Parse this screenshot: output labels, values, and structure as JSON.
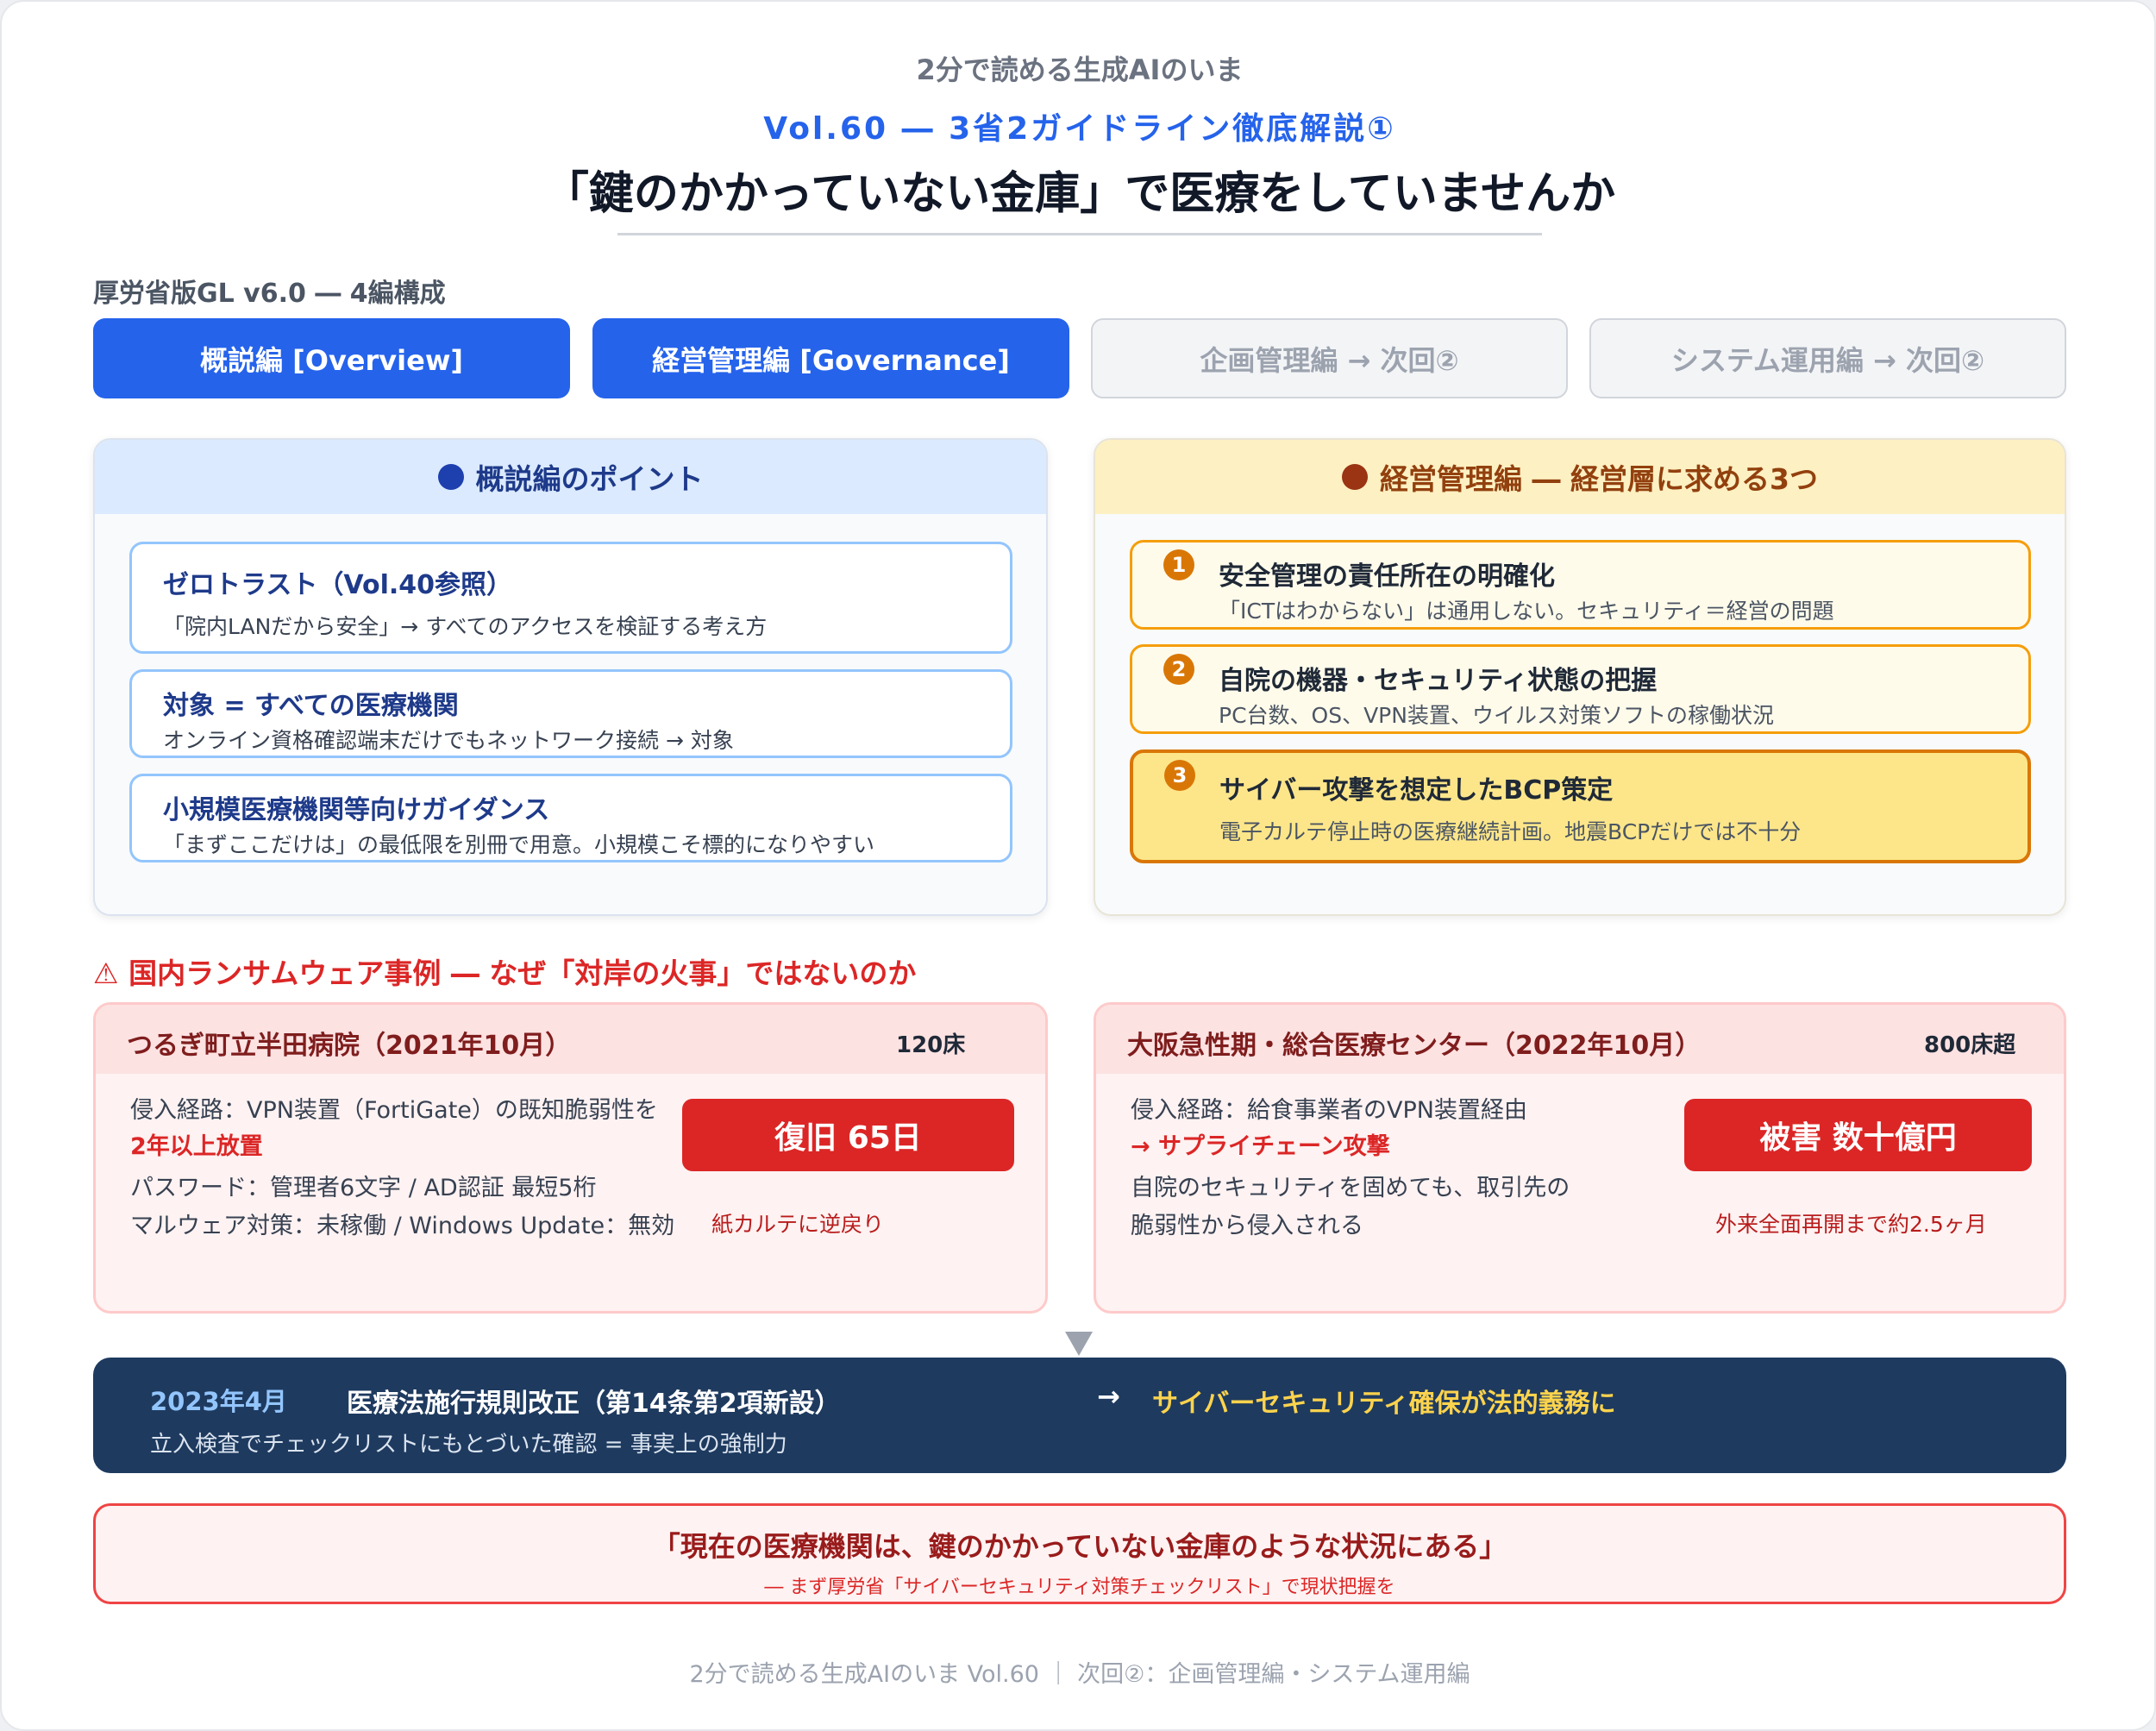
{
  "header": {
    "series": "2分で読める生成AIのいま",
    "volume": "Vol.60 ― 3省2ガイドライン徹底解説①",
    "title": "「鍵のかかっていない金庫」で医療をしていませんか"
  },
  "guideline_label": "厚労省版GL v6.0 ― 4編構成",
  "tabs": [
    {
      "label": "概説編 [Overview]",
      "active": true
    },
    {
      "label": "経営管理編 [Governance]",
      "active": true
    },
    {
      "label": "企画管理編 → 次回②",
      "active": false
    },
    {
      "label": "システム運用編 → 次回②",
      "active": false
    }
  ],
  "overview": {
    "heading": "概説編のポイント",
    "cards": [
      {
        "title": "ゼロトラスト（Vol.40参照）",
        "text": "「院内LANだから安全」→ すべてのアクセスを検証する考え方"
      },
      {
        "title": "対象 = すべての医療機関",
        "text": "オンライン資格確認端末だけでもネットワーク接続 → 対象"
      },
      {
        "title": "小規模医療機関等向けガイダンス",
        "text": "「まずここだけは」の最低限を別冊で用意。小規模こそ標的になりやすい"
      }
    ]
  },
  "governance": {
    "heading": "経営管理編 ― 経営層に求める3つ",
    "items": [
      {
        "num": "1",
        "title": "安全管理の責任所在の明確化",
        "text": "「ICTはわからない」は通用しない。セキュリティ＝経営の問題"
      },
      {
        "num": "2",
        "title": "自院の機器・セキュリティ状態の把握",
        "text": "PC台数、OS、VPN装置、ウイルス対策ソフトの稼働状況"
      },
      {
        "num": "3",
        "title": "サイバー攻撃を想定したBCP策定",
        "text": "電子カルテ停止時の医療継続計画。地震BCPだけでは不十分"
      }
    ]
  },
  "ransomware": {
    "heading": "⚠ 国内ランサムウェア事例 ― なぜ「対岸の火事」ではないのか",
    "cases": [
      {
        "name": "つるぎ町立半田病院（2021年10月）",
        "beds": "120床",
        "lines": [
          "侵入経路：VPN装置（FortiGate）の既知脆弱性を",
          "2年以上放置",
          "パスワード：管理者6文字 / AD認証 最短5桁",
          "マルウェア対策：未稼働 / Windows Update：無効"
        ],
        "badge": "復旧 65日",
        "note": "紙カルテに逆戻り"
      },
      {
        "name": "大阪急性期・総合医療センター（2022年10月）",
        "beds": "800床超",
        "lines": [
          "侵入経路：給食事業者のVPN装置経由",
          "→ サプライチェーン攻撃",
          "自院のセキュリティを固めても、取引先の",
          "脆弱性から侵入される"
        ],
        "badge": "被害 数十億円",
        "note": "外来全面再開まで約2.5ヶ月"
      }
    ]
  },
  "law": {
    "date": "2023年4月",
    "name": "医療法施行規則改正（第14条第2項新設）",
    "arrow": "→",
    "result": "サイバーセキュリティ確保が法的義務に",
    "sub": "立入検査でチェックリストにもとづいた確認 = 事実上の強制力"
  },
  "quote": {
    "main": "「現在の医療機関は、鍵のかかっていない金庫のような状況にある」",
    "sub": "― まず厚労省「サイバーセキュリティ対策チェックリスト」で現状把握を"
  },
  "footer": "2分で読める生成AIのいま Vol.60 ｜ 次回②：企画管理編・システム運用編",
  "colors": {
    "accent": "#2563eb",
    "navy": "#1e3a5f",
    "alert": "#dc2626",
    "amber": "#d97706"
  }
}
